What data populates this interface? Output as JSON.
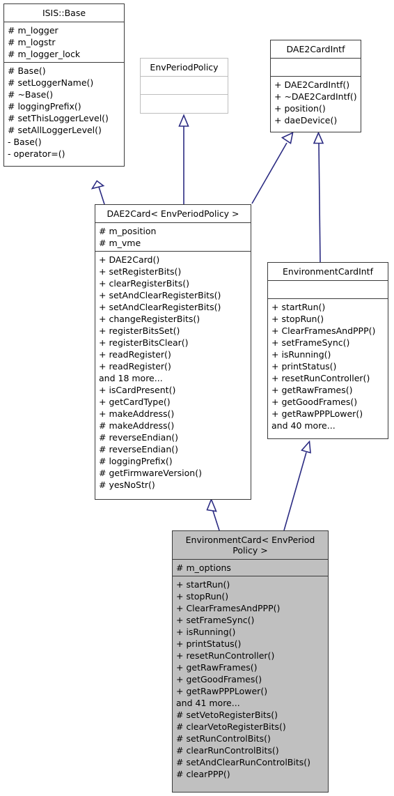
{
  "diagram": {
    "kind": "uml-class-inheritance-diagram",
    "background": "#ffffff",
    "edge_color": "#2b2b82",
    "box_border": "#3a3a3a",
    "faint_border": "#bdbdbd",
    "shaded_fill": "#c0c0c0"
  },
  "classes": {
    "isis_base": {
      "name": "ISIS::Base",
      "attributes": [
        "# m_logger",
        "# m_logstr",
        "# m_logger_lock"
      ],
      "operations": [
        "# Base()",
        "# setLoggerName()",
        "# ~Base()",
        "# loggingPrefix()",
        "# setThisLoggerLevel()",
        "# setAllLoggerLevel()",
        "- Base()",
        "- operator=()"
      ]
    },
    "env_period_policy": {
      "name": "EnvPeriodPolicy",
      "attributes": [],
      "operations": []
    },
    "dae2card_intf": {
      "name": "DAE2CardIntf",
      "attributes": [],
      "operations": [
        "+ DAE2CardIntf()",
        "+ ~DAE2CardIntf()",
        "+ position()",
        "+ daeDevice()"
      ]
    },
    "dae2card": {
      "name": "DAE2Card< EnvPeriodPolicy >",
      "attributes": [
        "# m_position",
        "# m_vme"
      ],
      "operations": [
        "+ DAE2Card()",
        "+ setRegisterBits()",
        "+ clearRegisterBits()",
        "+ setAndClearRegisterBits()",
        "+ setAndClearRegisterBits()",
        "+ changeRegisterBits()",
        "+ registerBitsSet()",
        "+ registerBitsClear()",
        "+ readRegister()",
        "+ readRegister()",
        "and 18 more...",
        "+ isCardPresent()",
        "+ getCardType()",
        "+ makeAddress()",
        "# makeAddress()",
        "# reverseEndian()",
        "# reverseEndian()",
        "# loggingPrefix()",
        "# getFirmwareVersion()",
        "# yesNoStr()"
      ]
    },
    "environment_card_intf": {
      "name": "EnvironmentCardIntf",
      "attributes": [],
      "operations": [
        "+ startRun()",
        "+ stopRun()",
        "+ ClearFramesAndPPP()",
        "+ setFrameSync()",
        "+ isRunning()",
        "+ printStatus()",
        "+ resetRunController()",
        "+ getRawFrames()",
        "+ getGoodFrames()",
        "+ getRawPPPLower()",
        "and 40 more..."
      ]
    },
    "environment_card": {
      "name": "EnvironmentCard< EnvPeriod\nPolicy >",
      "attributes": [
        "# m_options"
      ],
      "operations": [
        "+ startRun()",
        "+ stopRun()",
        "+ ClearFramesAndPPP()",
        "+ setFrameSync()",
        "+ isRunning()",
        "+ printStatus()",
        "+ resetRunController()",
        "+ getRawFrames()",
        "+ getGoodFrames()",
        "+ getRawPPPLower()",
        "and 41 more...",
        "# setVetoRegisterBits()",
        "# clearVetoRegisterBits()",
        "# setRunControlBits()",
        "# clearRunControlBits()",
        "# setAndClearRunControlBits()",
        "# clearPPP()"
      ]
    }
  },
  "relations": [
    {
      "from": "dae2card",
      "to": "isis_base",
      "type": "inheritance"
    },
    {
      "from": "dae2card",
      "to": "env_period_policy",
      "type": "inheritance"
    },
    {
      "from": "dae2card",
      "to": "dae2card_intf",
      "type": "inheritance"
    },
    {
      "from": "environment_card_intf",
      "to": "dae2card_intf",
      "type": "inheritance"
    },
    {
      "from": "environment_card",
      "to": "dae2card",
      "type": "inheritance"
    },
    {
      "from": "environment_card",
      "to": "environment_card_intf",
      "type": "inheritance"
    }
  ]
}
